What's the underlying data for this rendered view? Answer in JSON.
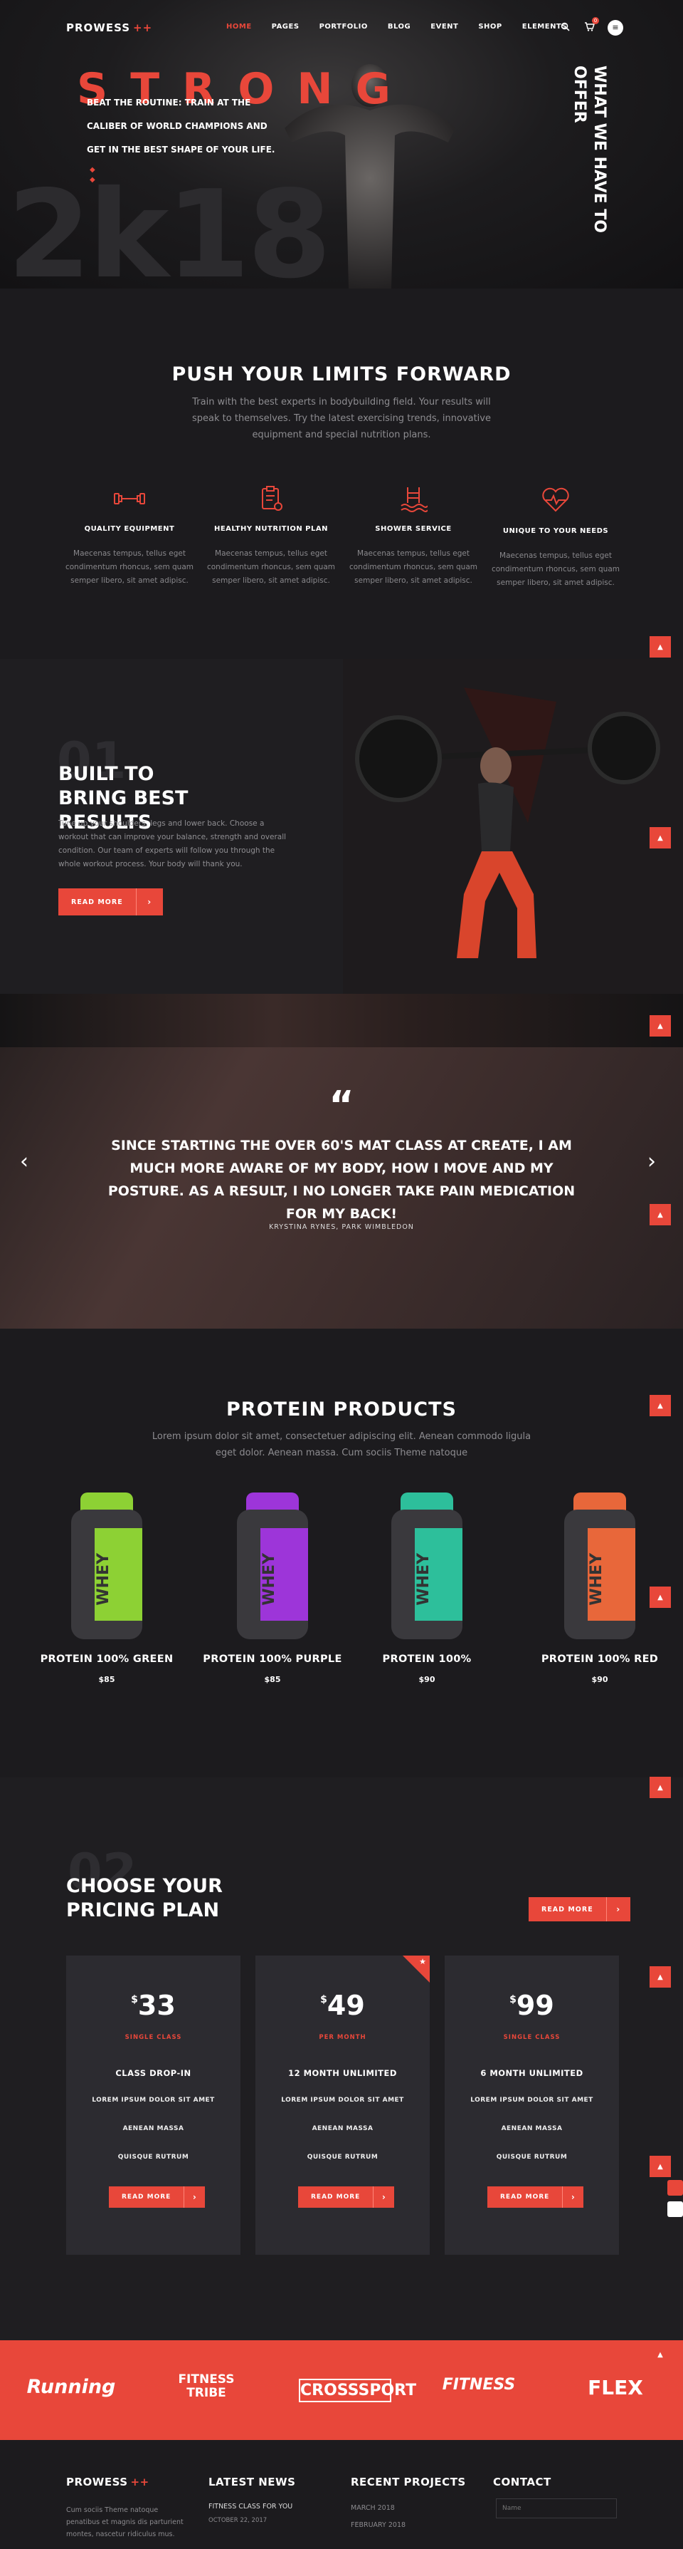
{
  "header": {
    "logo": "PROWESS",
    "logo_mark": "++",
    "nav": [
      "HOME",
      "PAGES",
      "PORTFOLIO",
      "BLOG",
      "EVENT",
      "SHOP",
      "ELEMENTS"
    ],
    "cart_count": "0"
  },
  "hero": {
    "headline": "STRONG",
    "text": "BEAT THE ROUTINE: TRAIN AT THE CALIBER OF WORLD CHAMPIONS AND GET IN THE BEST SHAPE OF YOUR LIFE.",
    "watermark": "2k18",
    "vertical": "WHAT WE HAVE TO OFFER"
  },
  "features": {
    "title": "PUSH YOUR LIMITS FORWARD",
    "subtitle": "Train with the best experts in bodybuilding field. Your results will speak to themselves. Try the latest exercising trends, innovative equipment and special nutrition plans.",
    "items": [
      {
        "title": "QUALITY EQUIPMENT",
        "text": "Maecenas tempus, tellus eget condimentum rhoncus, sem quam semper libero, sit amet adipisc."
      },
      {
        "title": "HEALTHY NUTRITION PLAN",
        "text": "Maecenas tempus, tellus eget condimentum rhoncus, sem quam semper libero, sit amet adipisc."
      },
      {
        "title": "SHOWER SERVICE",
        "text": "Maecenas tempus, tellus eget condimentum rhoncus, sem quam semper libero, sit amet adipisc."
      },
      {
        "title": "UNIQUE TO YOUR NEEDS",
        "text": "Maecenas tempus, tellus eget condimentum rhoncus, sem quam semper libero, sit amet adipisc."
      }
    ]
  },
  "built": {
    "number": "01",
    "title": "BUILT TO BRING BEST RESULTS",
    "text": "Tune up your shoulders, legs and lower back. Choose a workout that can improve your balance, strength and overall condition. Our team of experts will follow you through the whole workout process. Your body will thank you.",
    "button": "READ MORE"
  },
  "testimonial": {
    "quote_mark": "“",
    "quote": "SINCE STARTING THE OVER 60'S MAT CLASS AT CREATE, I AM MUCH MORE AWARE OF MY BODY, HOW I MOVE AND MY POSTURE. AS A RESULT, I NO LONGER TAKE PAIN MEDICATION FOR MY BACK!",
    "author": "KRYSTINA RYNES, PARK WIMBLEDON"
  },
  "products": {
    "title": "PROTEIN PRODUCTS",
    "subtitle": "Lorem ipsum dolor sit amet, consectetuer adipiscing elit. Aenean commodo ligula eget dolor. Aenean massa. Cum sociis Theme natoque",
    "items": [
      {
        "name": "PROTEIN 100% GREEN",
        "price": "$85",
        "color": "#8dd134"
      },
      {
        "name": "PROTEIN 100% PURPLE",
        "price": "$85",
        "color": "#9d35d9"
      },
      {
        "name": "PROTEIN 100%",
        "price": "$90",
        "color": "#2dbf9b"
      },
      {
        "name": "PROTEIN 100% RED",
        "price": "$90",
        "color": "#e8673a"
      }
    ],
    "tub_label": "WHEY",
    "tub_pct": "100%"
  },
  "pricing": {
    "number": "02",
    "title": "CHOOSE YOUR PRICING PLAN",
    "button": "READ MORE",
    "plans": [
      {
        "currency": "$",
        "amount": "33",
        "period": "SINGLE CLASS",
        "name": "CLASS DROP-IN",
        "lines": [
          "LOREM IPSUM DOLOR SIT AMET",
          "AENEAN MASSA",
          "QUISQUE RUTRUM"
        ],
        "button": "READ MORE"
      },
      {
        "currency": "$",
        "amount": "49",
        "period": "PER MONTH",
        "name": "12 MONTH UNLIMITED",
        "lines": [
          "LOREM IPSUM DOLOR SIT AMET",
          "AENEAN MASSA",
          "QUISQUE RUTRUM"
        ],
        "button": "READ MORE"
      },
      {
        "currency": "$",
        "amount": "99",
        "period": "SINGLE CLASS",
        "name": "6 MONTH UNLIMITED",
        "lines": [
          "LOREM IPSUM DOLOR SIT AMET",
          "AENEAN MASSA",
          "QUISQUE RUTRUM"
        ],
        "button": "READ MORE"
      }
    ]
  },
  "brands": [
    "Running",
    "FITNESS TRIBE",
    "CROSSSPORT",
    "FITNESS",
    "FLEX"
  ],
  "footer": {
    "logo": "PROWESS",
    "logo_mark": "++",
    "text": "Cum sociis Theme natoque penatibus et magnis dis parturient montes, nascetur ridiculus mus.",
    "news_title": "LATEST NEWS",
    "news_item": "FITNESS CLASS FOR YOU",
    "news_date": "OCTOBER 22, 2017",
    "projects_title": "RECENT PROJECTS",
    "projects": [
      "MARCH 2018",
      "FEBRUARY 2018"
    ],
    "contact_title": "CONTACT",
    "contact_placeholder": "Name"
  },
  "colors": {
    "accent": "#e8473a",
    "bg": "#1c1b1e"
  }
}
